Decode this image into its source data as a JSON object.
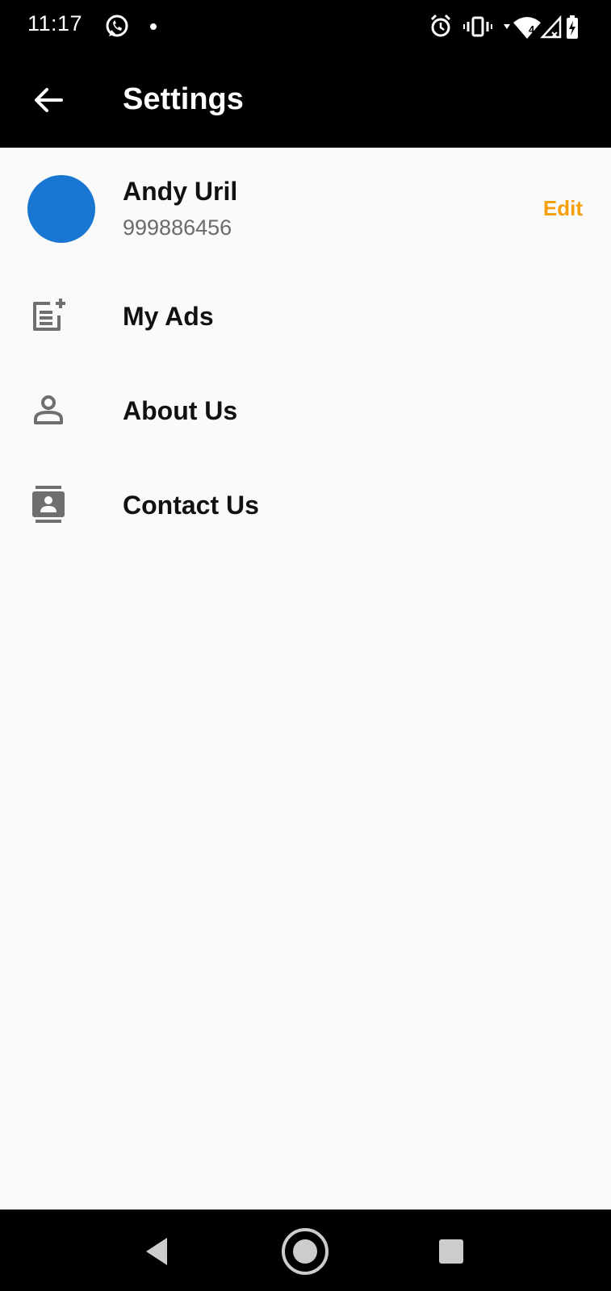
{
  "status_bar": {
    "time": "11:17",
    "left_icons": [
      "whatsapp-icon",
      "dot-icon"
    ],
    "right_icons": [
      "alarm-icon",
      "vibrate-icon",
      "wifi-icon",
      "signal-icon",
      "battery-charging-icon"
    ],
    "wifi_badge": "4"
  },
  "app_bar": {
    "title": "Settings",
    "back_icon": "arrow-back-icon"
  },
  "profile": {
    "name": "Andy Uril",
    "phone": "999886456",
    "edit_label": "Edit",
    "avatar_color": "#1976d2",
    "edit_color": "#f5a00b"
  },
  "menu": {
    "items": [
      {
        "label": "My Ads",
        "icon": "post-add-icon"
      },
      {
        "label": "About Us",
        "icon": "person-outline-icon"
      },
      {
        "label": "Contact Us",
        "icon": "contacts-icon"
      }
    ]
  },
  "nav_bar": {
    "buttons": [
      "back-triangle-icon",
      "home-circle-icon",
      "recents-square-icon"
    ]
  }
}
